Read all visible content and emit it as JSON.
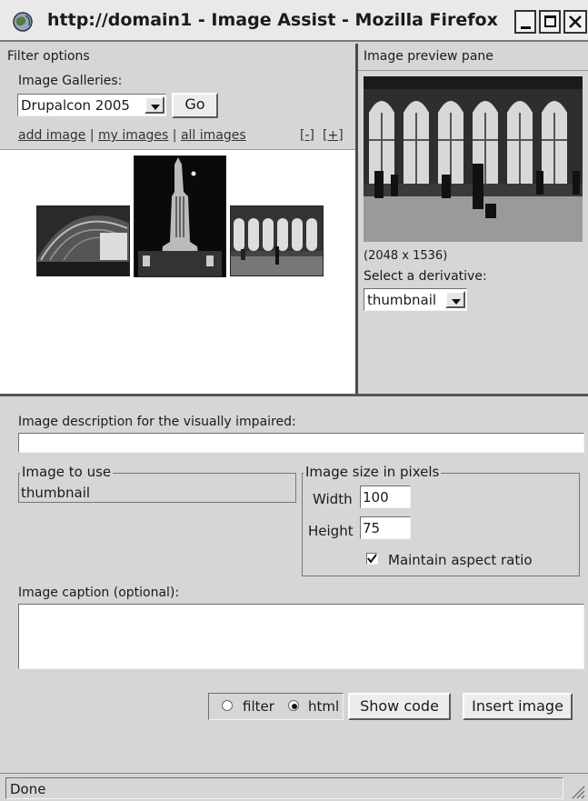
{
  "window": {
    "title": "http://domain1 - Image Assist - Mozilla Firefox",
    "minimize": "_",
    "maximize": "□",
    "close": "×"
  },
  "filter": {
    "heading": "Filter options",
    "galleries_label": "Image Galleries:",
    "gallery_selected": "Drupalcon 2005",
    "go_label": "Go",
    "links": {
      "add": "add image",
      "sep1": "|",
      "mine": "my images",
      "sep2": "|",
      "all": "all images"
    },
    "collapse": "[-]",
    "expand": "[+]"
  },
  "preview": {
    "heading": "Image preview pane",
    "dimensions": "(2048 x 1536)",
    "derivative_label": "Select a derivative:",
    "derivative_selected": "thumbnail"
  },
  "form": {
    "description_label": "Image description for the visually impaired:",
    "description_value": "",
    "image_to_use_legend": "Image to use",
    "image_to_use_value": "thumbnail",
    "size_legend": "Image size in pixels",
    "width_label": "Width",
    "width_value": "100",
    "height_label": "Height",
    "height_value": "75",
    "aspect_label": "Maintain aspect ratio",
    "aspect_checked": true,
    "caption_label": "Image caption (optional):",
    "caption_value": "",
    "filter_label": "filter",
    "html_label": "html",
    "mode_selected": "html",
    "show_code_label": "Show code",
    "insert_label": "Insert image"
  },
  "status": {
    "text": "Done"
  }
}
